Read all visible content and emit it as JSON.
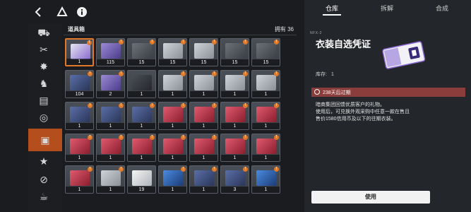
{
  "topbar": {
    "back_icon": "chevron-left-icon",
    "drive_icon": "triangle-icon",
    "info_icon": "info-icon"
  },
  "rail": {
    "items": [
      "vehicle-icon",
      "blade-icon",
      "gear-icon",
      "bust-icon",
      "document-icon",
      "target-icon",
      "stack-icon",
      "star-icon",
      "slash-icon",
      "cup-icon"
    ]
  },
  "bag": {
    "title": "道具箱",
    "count_label": "拥有 36"
  },
  "items": [
    {
      "tier": "card",
      "qty": "1",
      "badge": "!",
      "selected": true
    },
    {
      "tier": "purple",
      "qty": "115",
      "badge": "!"
    },
    {
      "tier": "box",
      "qty": "15",
      "badge": "!"
    },
    {
      "tier": "silver",
      "qty": "15",
      "badge": "!"
    },
    {
      "tier": "silver",
      "qty": "15",
      "badge": "!"
    },
    {
      "tier": "box",
      "qty": "15",
      "badge": "!"
    },
    {
      "tier": "box",
      "qty": "15",
      "badge": "!"
    },
    {
      "tier": "navy",
      "qty": "104",
      "badge": "!"
    },
    {
      "tier": "purple",
      "qty": "2",
      "badge": "!"
    },
    {
      "tier": "dark",
      "qty": "1",
      "badge": ""
    },
    {
      "tier": "silver",
      "qty": "1",
      "badge": "!"
    },
    {
      "tier": "silver",
      "qty": "1",
      "badge": "!"
    },
    {
      "tier": "silver",
      "qty": "1",
      "badge": "!"
    },
    {
      "tier": "silver",
      "qty": "1",
      "badge": "!"
    },
    {
      "tier": "navy",
      "qty": "1",
      "badge": "!"
    },
    {
      "tier": "navy",
      "qty": "1",
      "badge": "!"
    },
    {
      "tier": "navy",
      "qty": "1",
      "badge": "!"
    },
    {
      "tier": "red",
      "qty": "1",
      "badge": "!"
    },
    {
      "tier": "red",
      "qty": "1",
      "badge": "!"
    },
    {
      "tier": "red",
      "qty": "1",
      "badge": "!"
    },
    {
      "tier": "red",
      "qty": "1",
      "badge": "!"
    },
    {
      "tier": "red",
      "qty": "1",
      "badge": "!"
    },
    {
      "tier": "red",
      "qty": "1",
      "badge": "!"
    },
    {
      "tier": "red",
      "qty": "1",
      "badge": "!"
    },
    {
      "tier": "red",
      "qty": "1",
      "badge": "!"
    },
    {
      "tier": "red",
      "qty": "1",
      "badge": "!"
    },
    {
      "tier": "red",
      "qty": "1",
      "badge": "!"
    },
    {
      "tier": "red",
      "qty": "1",
      "badge": "!"
    },
    {
      "tier": "red",
      "qty": "1",
      "badge": "!"
    },
    {
      "tier": "silver",
      "qty": "1",
      "badge": "!"
    },
    {
      "tier": "white",
      "qty": "19",
      "badge": ""
    },
    {
      "tier": "blue",
      "qty": "1",
      "badge": "!"
    },
    {
      "tier": "navy",
      "qty": "1",
      "badge": "!"
    },
    {
      "tier": "navy",
      "qty": "3",
      "badge": "!"
    },
    {
      "tier": "blue",
      "qty": "1",
      "badge": "!"
    }
  ],
  "panel": {
    "tabs": [
      "仓库",
      "拆解",
      "合成"
    ],
    "active_tab": 0,
    "tagline": "NFX-2",
    "item_name": "衣装自选凭证",
    "stock_label": "库存:",
    "stock_value": "1",
    "expiry": "238天后过期",
    "description": [
      "暗商集团回馈优质客户的礼物。",
      "使用后，可兑换外观采购中任意一款在售且",
      "售价1580信用币及以下的往期衣装。"
    ],
    "use_button": "使用"
  },
  "colors": {
    "accent": "#e07a2a",
    "active_rail": "#b44e1c",
    "expiry_bar": "#8a3d3a",
    "panel_bg": "#23262a"
  }
}
